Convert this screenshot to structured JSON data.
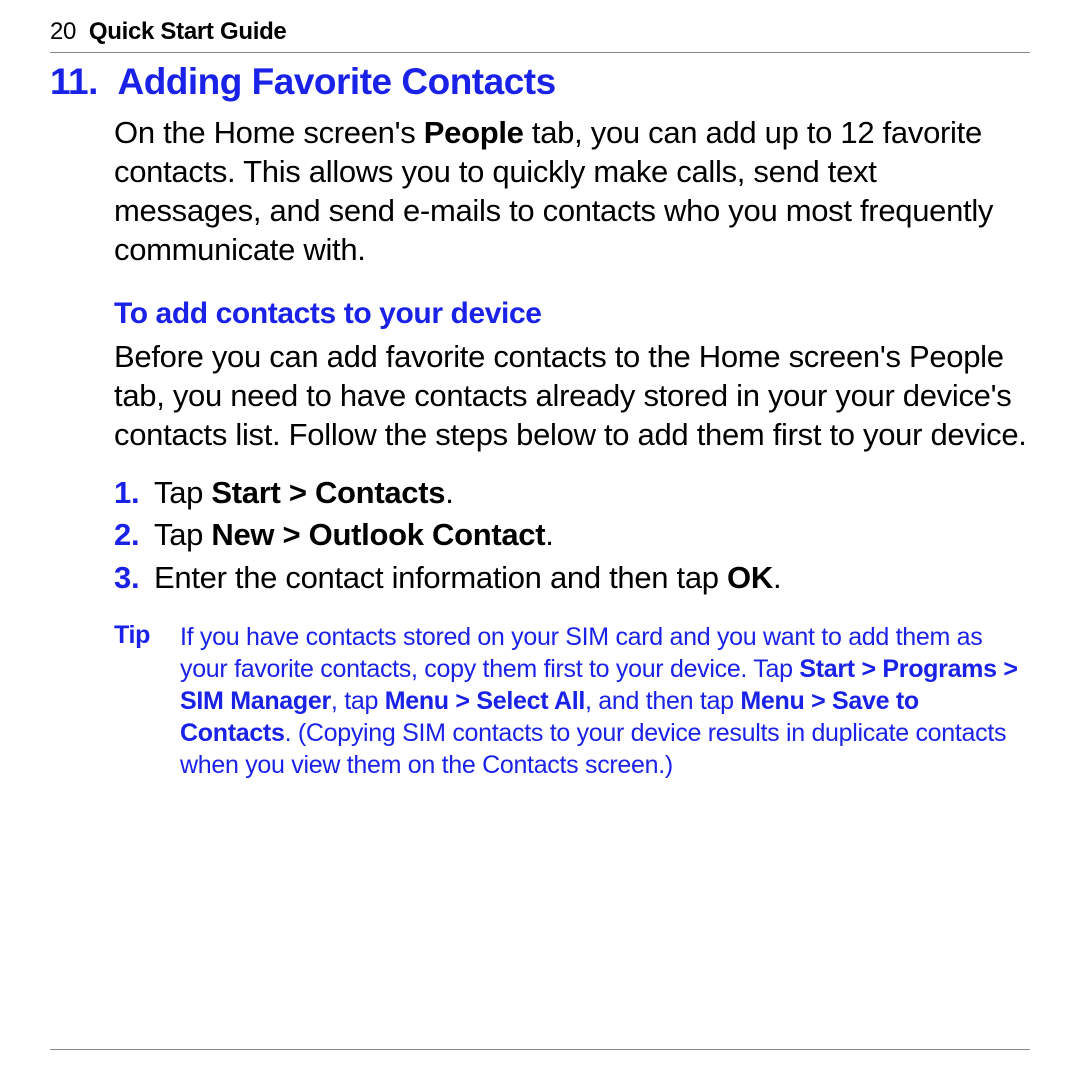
{
  "header": {
    "page_number": "20",
    "book_title": "Quick Start Guide"
  },
  "section": {
    "number": "11.",
    "title": "Adding Favorite Contacts"
  },
  "intro": {
    "pre": "On the Home screen's ",
    "bold1": "People",
    "post": " tab, you can add up to 12 favorite contacts. This allows you to quickly make calls, send text messages, and send e-mails to contacts who you most frequently communicate with."
  },
  "sub_heading": "To add contacts to your device",
  "body": "Before you can add favorite contacts to the Home screen's People tab, you need to have contacts already stored in your your device's contacts list. Follow the steps below to add them first to your device.",
  "steps": [
    {
      "num": "1.",
      "pre": "Tap ",
      "bold": "Start > Contacts",
      "post": "."
    },
    {
      "num": "2.",
      "pre": "Tap ",
      "bold": "New > Outlook Contact",
      "post": "."
    },
    {
      "num": "3.",
      "pre": "Enter the contact information and then tap ",
      "bold": "OK",
      "post": "."
    }
  ],
  "tip": {
    "label": "Tip",
    "seg1": "If you have contacts stored on your SIM card and you want to add them as your favorite contacts, copy them first to your device. Tap ",
    "bold1": "Start > Programs > SIM Manager",
    "seg2": ", tap ",
    "bold2": "Menu > Select All",
    "seg3": ", and then tap ",
    "bold3": "Menu > Save to Contacts",
    "seg4": ". (Copying SIM contacts to your device results in duplicate contacts when you view them on the Contacts screen.)"
  }
}
